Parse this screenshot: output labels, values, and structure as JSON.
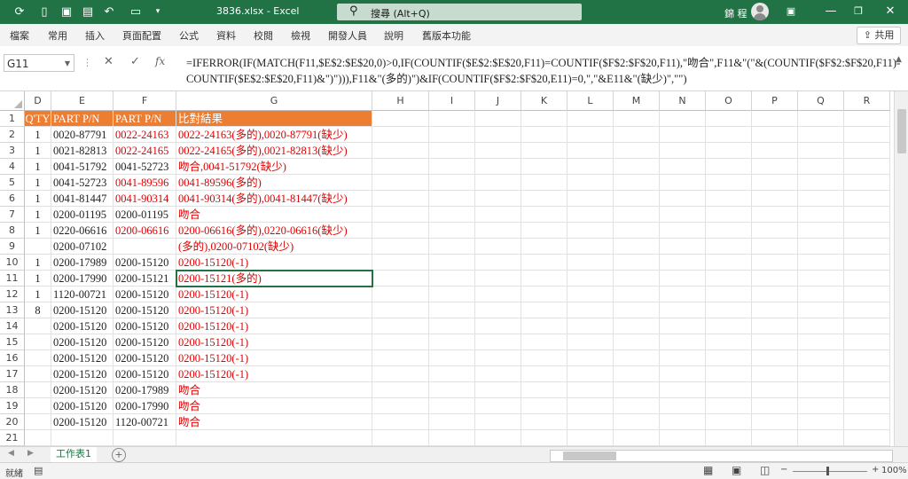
{
  "titlebar": {
    "filename": "3836.xlsx",
    "separator": "-",
    "app": "Excel",
    "search_placeholder": "搜尋 (Alt+Q)",
    "user": "錦 程",
    "color": "#217346"
  },
  "ribbon": {
    "tabs": [
      "檔案",
      "常用",
      "插入",
      "頁面配置",
      "公式",
      "資料",
      "校閱",
      "檢視",
      "開發人員",
      "說明",
      "舊版本功能"
    ],
    "share": "共用"
  },
  "formula_bar": {
    "name_box": "G11",
    "fx": "fx",
    "line1": "=IFERROR(IF(MATCH(F11,$E$2:$E$20,0)>0,IF(COUNTIF($E$2:$E$20,F11)=COUNTIF($F$2:$F$20,F11),\"吻合\",F11&\"(\"&(COUNTIF($F$2:$F$20,F11)-",
    "line2": "COUNTIF($E$2:$E$20,F11)&\")\"))),F11&\"(多的)\")&IF(COUNTIF($F$2:$F$20,E11)=0,\",\"&E11&\"(缺少)\",\"\")"
  },
  "sheet": {
    "columns": [
      "D",
      "E",
      "F",
      "G",
      "H",
      "I",
      "J",
      "K",
      "L",
      "M",
      "N",
      "O",
      "P",
      "Q",
      "R"
    ],
    "header_fill": "#ed7d31",
    "rows": [
      {
        "n": "1",
        "d": "Q'TY",
        "e": "PART P/N",
        "f": "PART P/N",
        "g": "比對結果",
        "header": true
      },
      {
        "n": "2",
        "d": "1",
        "e": "0020-87791",
        "f": "0022-24163",
        "g": "0022-24163(多的),0020-87791(缺少)",
        "fred": true,
        "gred": true
      },
      {
        "n": "3",
        "d": "1",
        "e": "0021-82813",
        "f": "0022-24165",
        "g": "0022-24165(多的),0021-82813(缺少)",
        "fred": true,
        "gred": true
      },
      {
        "n": "4",
        "d": "1",
        "e": "0041-51792",
        "f": "0041-52723",
        "g": "吻合,0041-51792(缺少)",
        "fred": false,
        "gred": true
      },
      {
        "n": "5",
        "d": "1",
        "e": "0041-52723",
        "f": "0041-89596",
        "g": "0041-89596(多的)",
        "fred": true,
        "gred": true
      },
      {
        "n": "6",
        "d": "1",
        "e": "0041-81447",
        "f": "0041-90314",
        "g": "0041-90314(多的),0041-81447(缺少)",
        "fred": true,
        "gred": true
      },
      {
        "n": "7",
        "d": "1",
        "e": "0200-01195",
        "f": "0200-01195",
        "g": "吻合",
        "fred": false,
        "gred": true
      },
      {
        "n": "8",
        "d": "1",
        "e": "0220-06616",
        "f": "0200-06616",
        "g": "0200-06616(多的),0220-06616(缺少)",
        "fred": true,
        "gred": true
      },
      {
        "n": "9",
        "d": "",
        "e": "0200-07102",
        "f": "",
        "g": "(多的),0200-07102(缺少)",
        "fred": false,
        "gred": true
      },
      {
        "n": "10",
        "d": "1",
        "e": "0200-17989",
        "f": "0200-15120",
        "g": "0200-15120(-1)",
        "fred": false,
        "gred": true
      },
      {
        "n": "11",
        "d": "1",
        "e": "0200-17990",
        "f": "0200-15121",
        "g": "0200-15121(多的)",
        "fred": false,
        "gred": true,
        "selected": true
      },
      {
        "n": "12",
        "d": "1",
        "e": "1120-00721",
        "f": "0200-15120",
        "g": "0200-15120(-1)",
        "fred": false,
        "gred": true
      },
      {
        "n": "13",
        "d": "8",
        "e": "0200-15120",
        "f": "0200-15120",
        "g": "0200-15120(-1)",
        "fred": false,
        "gred": true
      },
      {
        "n": "14",
        "d": "",
        "e": "0200-15120",
        "f": "0200-15120",
        "g": "0200-15120(-1)",
        "fred": false,
        "gred": true
      },
      {
        "n": "15",
        "d": "",
        "e": "0200-15120",
        "f": "0200-15120",
        "g": "0200-15120(-1)",
        "fred": false,
        "gred": true
      },
      {
        "n": "16",
        "d": "",
        "e": "0200-15120",
        "f": "0200-15120",
        "g": "0200-15120(-1)",
        "fred": false,
        "gred": true
      },
      {
        "n": "17",
        "d": "",
        "e": "0200-15120",
        "f": "0200-15120",
        "g": "0200-15120(-1)",
        "fred": false,
        "gred": true
      },
      {
        "n": "18",
        "d": "",
        "e": "0200-15120",
        "f": "0200-17989",
        "g": "吻合",
        "fred": false,
        "gred": true
      },
      {
        "n": "19",
        "d": "",
        "e": "0200-15120",
        "f": "0200-17990",
        "g": "吻合",
        "fred": false,
        "gred": true
      },
      {
        "n": "20",
        "d": "",
        "e": "0200-15120",
        "f": "1120-00721",
        "g": "吻合",
        "fred": false,
        "gred": true
      },
      {
        "n": "21",
        "d": "",
        "e": "",
        "f": "",
        "g": ""
      }
    ]
  },
  "sheetbar": {
    "tab": "工作表1",
    "add": "+"
  },
  "status": {
    "ready": "就緒",
    "zoom": "100%",
    "minus": "−",
    "plus": "+"
  }
}
